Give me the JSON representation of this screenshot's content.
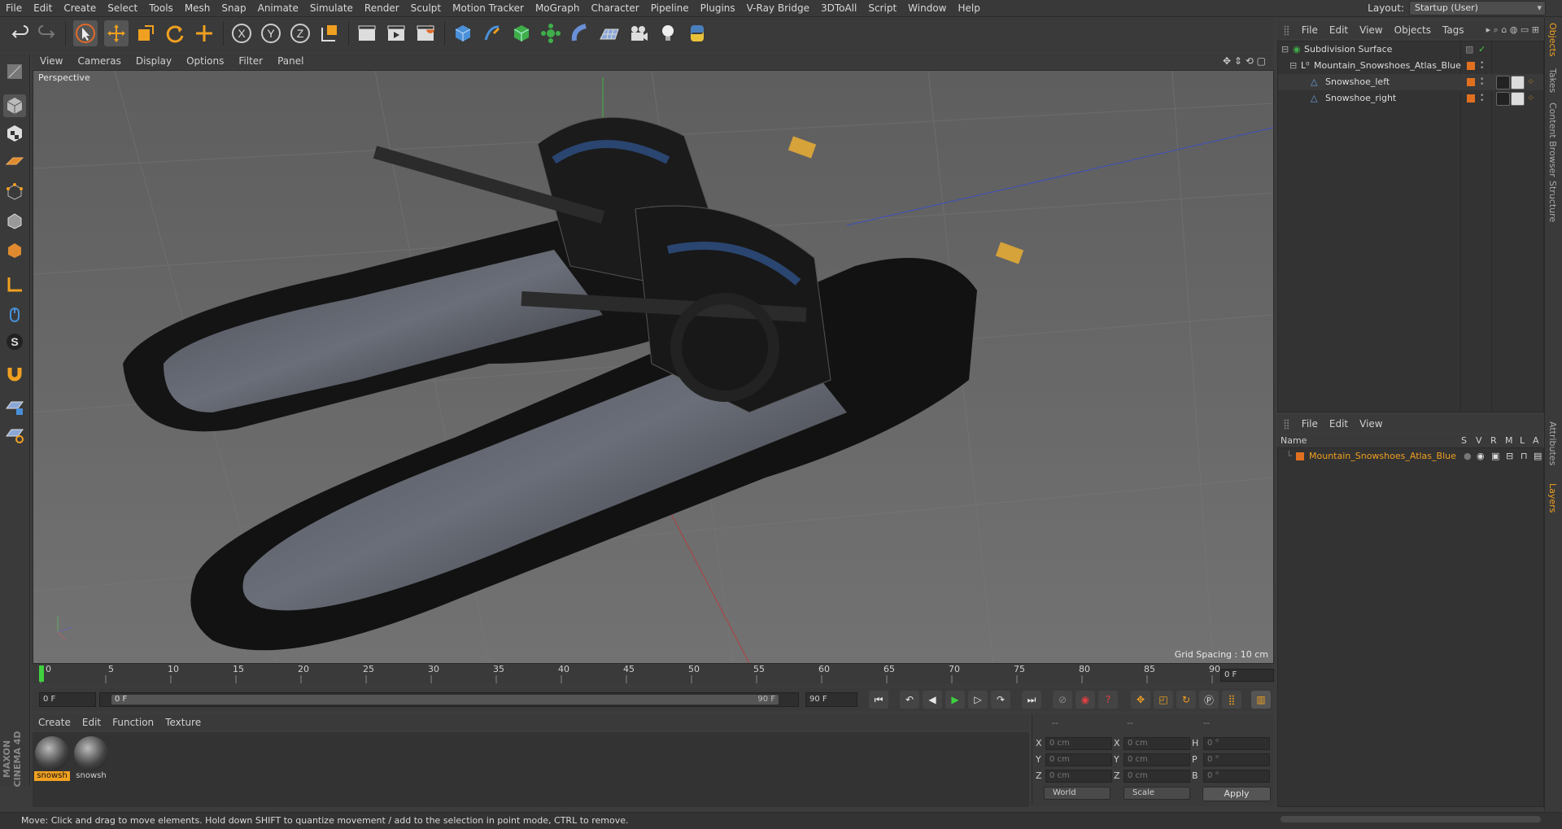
{
  "menubar": {
    "items": [
      "File",
      "Edit",
      "Create",
      "Select",
      "Tools",
      "Mesh",
      "Snap",
      "Animate",
      "Simulate",
      "Render",
      "Sculpt",
      "Motion Tracker",
      "MoGraph",
      "Character",
      "Pipeline",
      "Plugins",
      "V-Ray Bridge",
      "3DToAll",
      "Script",
      "Window",
      "Help"
    ],
    "layout_label": "Layout:",
    "layout_value": "Startup (User)"
  },
  "viewport": {
    "menu": [
      "View",
      "Cameras",
      "Display",
      "Options",
      "Filter",
      "Panel"
    ],
    "label": "Perspective",
    "grid_spacing": "Grid Spacing : 10 cm"
  },
  "timeline": {
    "ticks": [
      "0",
      "5",
      "10",
      "15",
      "20",
      "25",
      "30",
      "35",
      "40",
      "45",
      "50",
      "55",
      "60",
      "65",
      "70",
      "75",
      "80",
      "85",
      "90"
    ],
    "current_frame_box": "0 F",
    "start_field": "0 F",
    "range_start": "0 F",
    "range_end": "90 F",
    "end_field": "90 F"
  },
  "materials": {
    "menu": [
      "Create",
      "Edit",
      "Function",
      "Texture"
    ],
    "items": [
      {
        "label": "snowsh",
        "selected": true
      },
      {
        "label": "snowsh",
        "selected": false
      }
    ]
  },
  "coordinates": {
    "header": [
      "--",
      "--",
      "--"
    ],
    "rows": [
      {
        "a": "X",
        "av": "0 cm",
        "b": "X",
        "bv": "0 cm",
        "c": "H",
        "cv": "0 °"
      },
      {
        "a": "Y",
        "av": "0 cm",
        "b": "Y",
        "bv": "0 cm",
        "c": "P",
        "cv": "0 °"
      },
      {
        "a": "Z",
        "av": "0 cm",
        "b": "Z",
        "bv": "0 cm",
        "c": "B",
        "cv": "0 °"
      }
    ],
    "dropdown_world": "World",
    "dropdown_scale": "Scale",
    "apply": "Apply"
  },
  "object_manager": {
    "menu": [
      "File",
      "Edit",
      "View",
      "Objects",
      "Tags"
    ],
    "objects": [
      {
        "name": "Subdivision Surface"
      },
      {
        "name": "Mountain_Snowshoes_Atlas_Blue"
      },
      {
        "name": "Snowshoe_left"
      },
      {
        "name": "Snowshoe_right"
      }
    ]
  },
  "layer_manager": {
    "menu": [
      "File",
      "Edit",
      "View"
    ],
    "columns": [
      "Name",
      "S",
      "V",
      "R",
      "M",
      "L",
      "A"
    ],
    "layers": [
      {
        "name": "Mountain_Snowshoes_Atlas_Blue"
      }
    ]
  },
  "right_tabs": [
    "Objects",
    "Takes",
    "Content Browser",
    "Structure",
    "Attributes",
    "Layers"
  ],
  "status_text": "Move: Click and drag to move elements. Hold down SHIFT to quantize movement / add to the selection in point mode, CTRL to remove.",
  "logo": "MAXON CINEMA 4D",
  "colors": {
    "accent": "#f0a020",
    "layer_orange": "#e07020",
    "ui_bg": "#3a3a3a",
    "viewport_bg": "#6b6b6b"
  }
}
